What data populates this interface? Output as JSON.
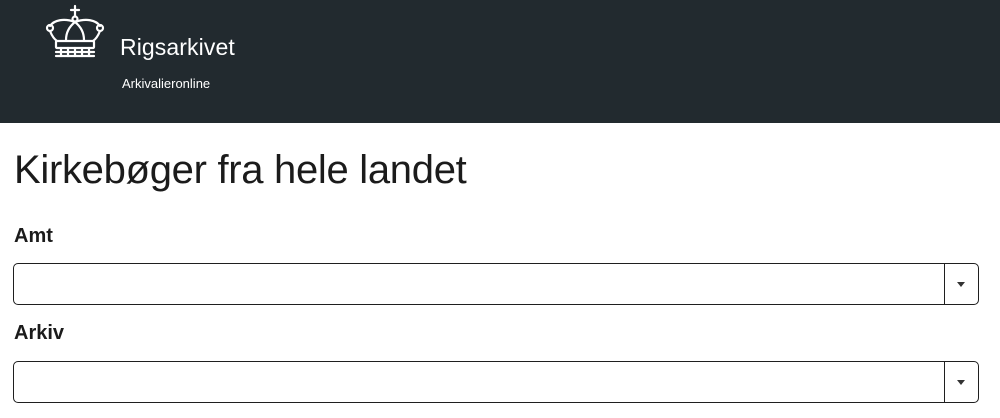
{
  "header": {
    "brand_name": "Rigsarkivet",
    "brand_sub": "Arkivalieronline",
    "logo_icon": "crown-icon",
    "background_color": "#222a2f"
  },
  "main": {
    "title": "Kirkebøger fra hele landet",
    "fields": [
      {
        "label": "Amt",
        "value": "",
        "icon": "chevron-down-icon"
      },
      {
        "label": "Arkiv",
        "value": "",
        "icon": "chevron-down-icon"
      }
    ]
  }
}
